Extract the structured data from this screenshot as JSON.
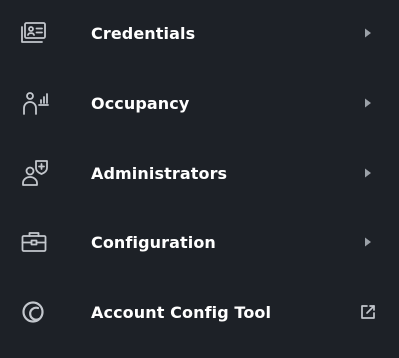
{
  "colors": {
    "background": "#1d2127",
    "text": "#ffffff",
    "icon": "#c3c7cd",
    "chevron": "#9ba1a8"
  },
  "menu": {
    "items": [
      {
        "label": "Credentials",
        "icon": "id-card-icon",
        "trailing": "chevron-right-icon"
      },
      {
        "label": "Occupancy",
        "icon": "person-chart-icon",
        "trailing": "chevron-right-icon"
      },
      {
        "label": "Administrators",
        "icon": "user-badge-icon",
        "trailing": "chevron-right-icon"
      },
      {
        "label": "Configuration",
        "icon": "toolbox-icon",
        "trailing": "chevron-right-icon"
      },
      {
        "label": "Account Config Tool",
        "icon": "circle-swirl-icon",
        "trailing": "external-link-icon"
      }
    ]
  }
}
